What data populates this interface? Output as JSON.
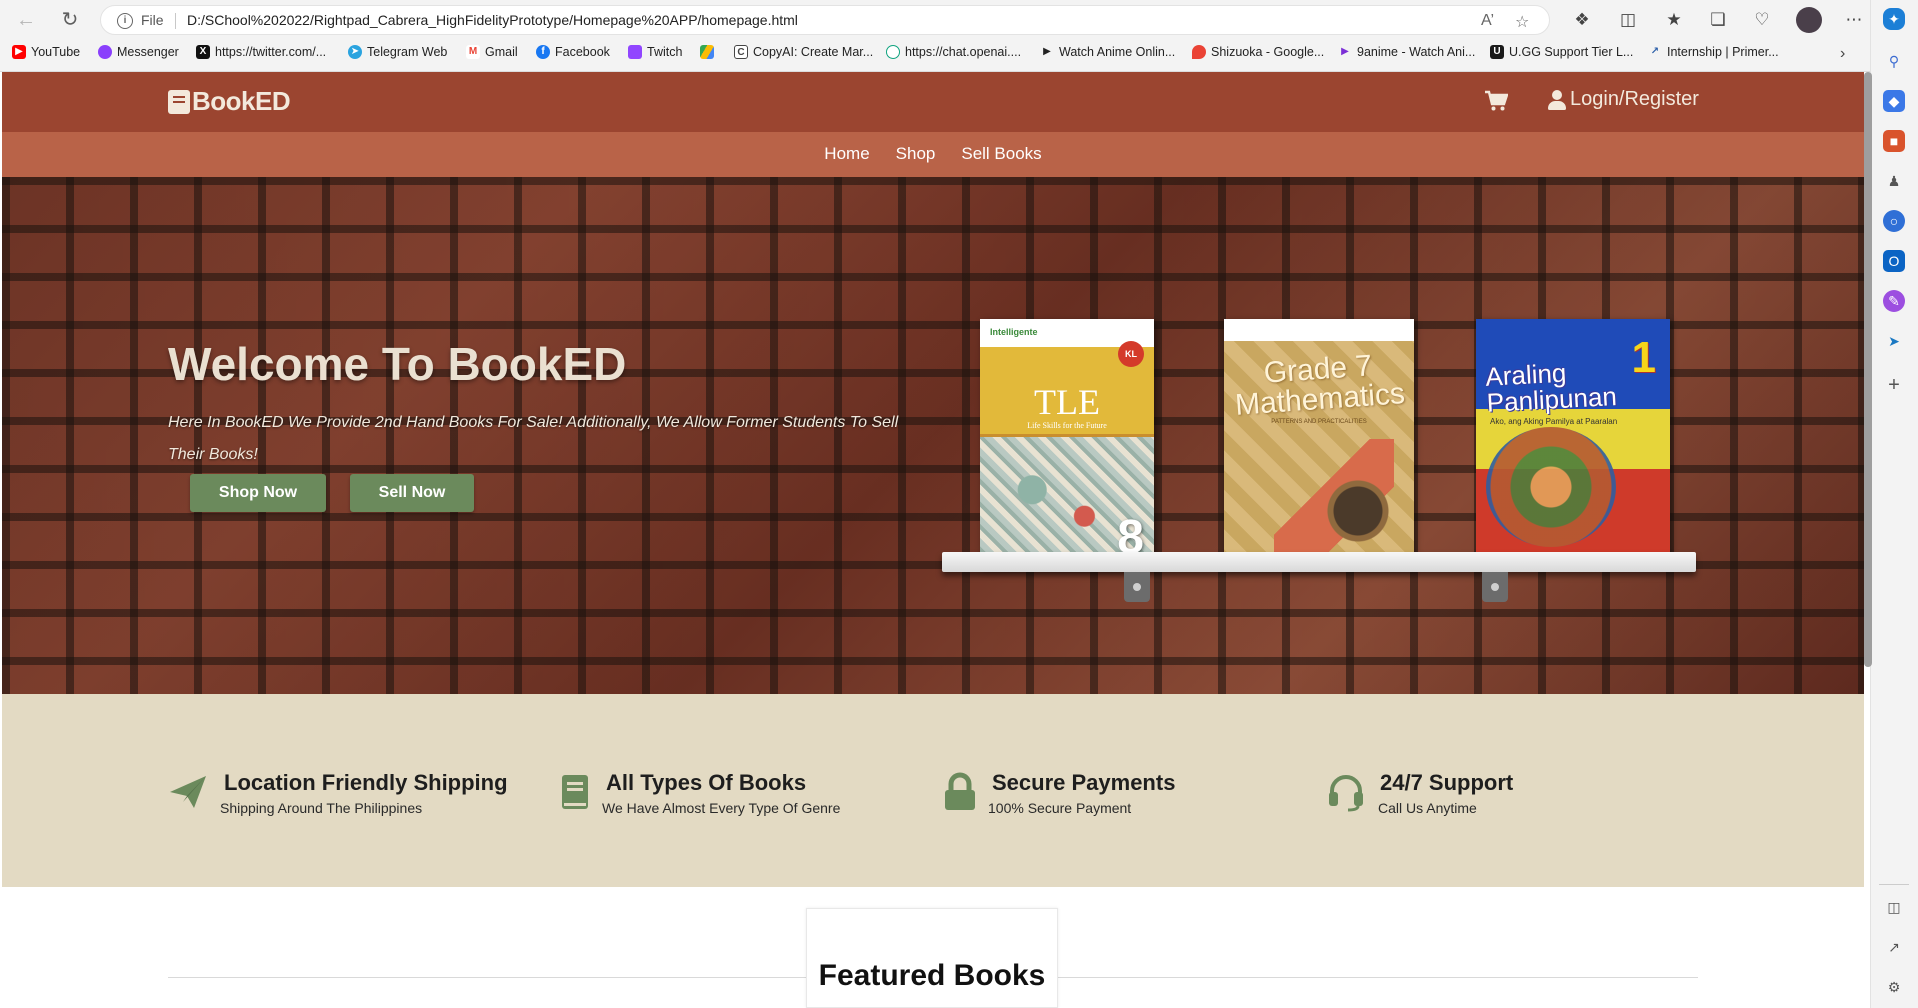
{
  "browser": {
    "file_label": "File",
    "url": "D:/SChool%202022/Rightpad_Cabrera_HighFidelityPrototype/Homepage%20APP/homepage.html",
    "bookmarks": [
      {
        "label": "YouTube",
        "color": "#ff0000"
      },
      {
        "label": "Messenger",
        "color": "#8a3ffc"
      },
      {
        "label": "https://twitter.com/...",
        "color": "#111111"
      },
      {
        "label": "Telegram Web",
        "color": "#2aa3df"
      },
      {
        "label": "Gmail",
        "color": "#ea4335"
      },
      {
        "label": "Facebook",
        "color": "#1877f2"
      },
      {
        "label": "Twitch",
        "color": "#9146ff"
      },
      {
        "label": "",
        "color": "#34a853"
      },
      {
        "label": "CopyAI: Create Mar...",
        "color": "#3a3a3a"
      },
      {
        "label": "https://chat.openai....",
        "color": "#10a37f"
      },
      {
        "label": "Watch Anime Onlin...",
        "color": "#222222"
      },
      {
        "label": "Shizuoka - Google...",
        "color": "#4285f4"
      },
      {
        "label": "9anime - Watch Ani...",
        "color": "#7b2fd6"
      },
      {
        "label": "U.GG Support Tier L...",
        "color": "#1a1a1a"
      },
      {
        "label": "Internship | Primer...",
        "color": "#2b5ea8"
      }
    ]
  },
  "site": {
    "logo": "BookED",
    "login": "Login/Register",
    "nav": [
      "Home",
      "Shop",
      "Sell Books"
    ],
    "colors": {
      "header": "#9b4530",
      "subnav": "#b96348",
      "accent": "#6b8a5c",
      "features_bg": "#e3dac3"
    }
  },
  "hero": {
    "title": "Welcome To BookED",
    "description": "Here In BookED We Provide 2nd Hand Books For Sale! Additionally, We Allow Former Students To Sell Their Books!",
    "shop_button": "Shop Now",
    "sell_button": "Sell Now",
    "books": [
      {
        "title": "TLE",
        "subtitle": "Life Skills for the Future",
        "brand": "Intelligente",
        "badge": "KL",
        "number": "8"
      },
      {
        "title": "Grade 7 Mathematics",
        "subtitle": "PATTERNS AND PRACTICALITIES"
      },
      {
        "title": "Araling Panlipunan",
        "subtitle": "Ako, ang Aking Pamilya at Paaralan",
        "number": "1"
      }
    ]
  },
  "features": [
    {
      "icon": "paper-plane-icon",
      "title": "Location Friendly Shipping",
      "subtitle": "Shipping Around The Philippines"
    },
    {
      "icon": "book-icon",
      "title": "All Types Of Books",
      "subtitle": "We Have Almost Every Type Of Genre"
    },
    {
      "icon": "lock-icon",
      "title": "Secure Payments",
      "subtitle": "100% Secure Payment"
    },
    {
      "icon": "headset-icon",
      "title": "24/7 Support",
      "subtitle": "Call Us Anytime"
    }
  ],
  "featured": {
    "title": "Featured Books"
  }
}
